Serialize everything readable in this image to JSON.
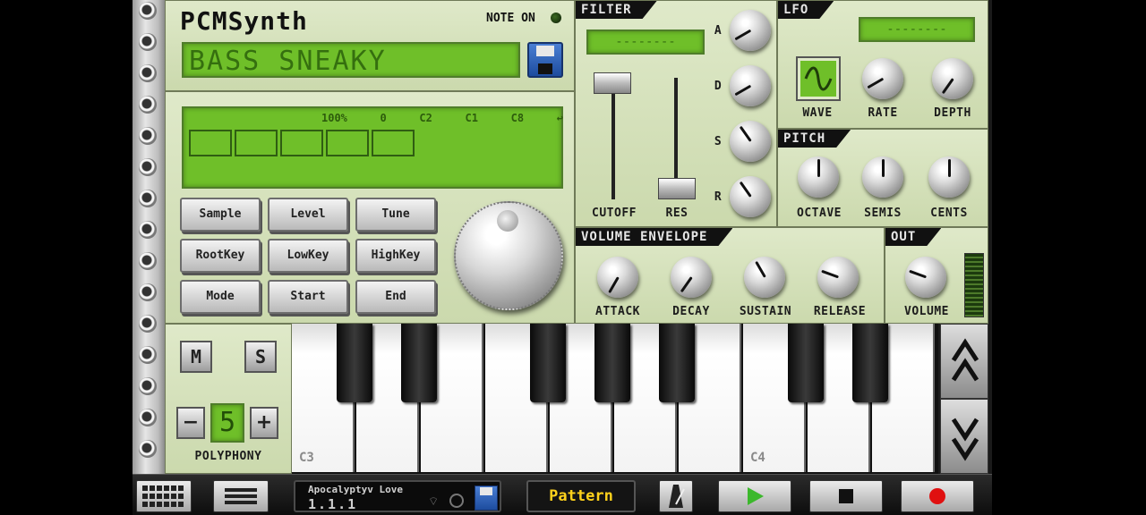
{
  "synth": {
    "title": "PCMSynth",
    "note_on": "NOTE ON",
    "patch_name": "BASS SNEAKY",
    "sample_header": [
      "100%",
      "0",
      "C2",
      "C1",
      "C8"
    ],
    "buttons": [
      "Sample",
      "Level",
      "Tune",
      "RootKey",
      "LowKey",
      "HighKey",
      "Mode",
      "Start",
      "End"
    ]
  },
  "filter": {
    "title": "FILTER",
    "lcd": "--------",
    "cutoff": "CUTOFF",
    "res": "RES",
    "adsr": [
      "A",
      "D",
      "S",
      "R"
    ]
  },
  "lfo": {
    "title": "LFO",
    "lcd": "--------",
    "wave": "WAVE",
    "rate": "RATE",
    "depth": "DEPTH"
  },
  "pitch": {
    "title": "PITCH",
    "octave": "OCTAVE",
    "semis": "SEMIS",
    "cents": "CENTS"
  },
  "envelope": {
    "title": "VOLUME ENVELOPE",
    "attack": "ATTACK",
    "decay": "DECAY",
    "sustain": "SUSTAIN",
    "release": "RELEASE"
  },
  "out": {
    "title": "OUT",
    "volume": "VOLUME"
  },
  "voice": {
    "mute": "M",
    "solo": "S",
    "minus": "−",
    "plus": "+",
    "polyphony_value": "5",
    "polyphony_label": "POLYPHONY"
  },
  "keyboard": {
    "labels": [
      "C3",
      "C4"
    ]
  },
  "bottom": {
    "song_name": "Apocalyptyv Love",
    "position": "1.1.1",
    "pattern": "Pattern"
  },
  "colors": {
    "lcd": "#6fbf29",
    "panel": "#d6e3bb",
    "play": "#3cb82c",
    "record": "#e01010"
  }
}
